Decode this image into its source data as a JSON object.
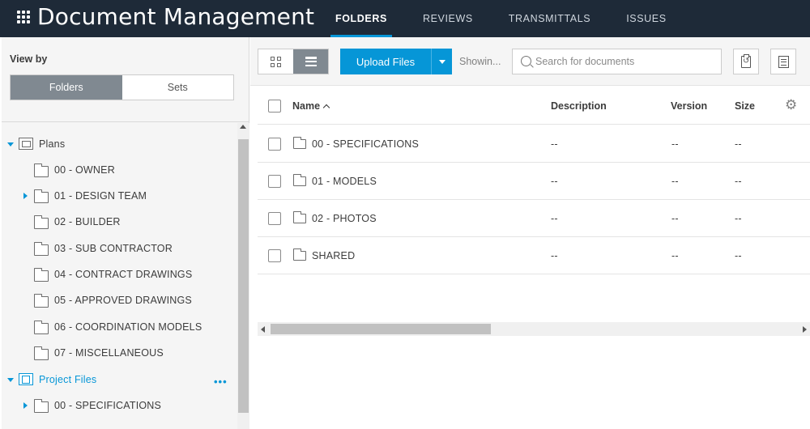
{
  "app": {
    "title": "Document Management"
  },
  "topnav": {
    "tabs": [
      {
        "label": "FOLDERS",
        "active": true
      },
      {
        "label": "REVIEWS",
        "active": false
      },
      {
        "label": "TRANSMITTALS",
        "active": false
      },
      {
        "label": "ISSUES",
        "active": false
      }
    ]
  },
  "sidebar": {
    "view_by_label": "View by",
    "toggle": {
      "folders_label": "Folders",
      "sets_label": "Sets",
      "selected": "Folders"
    },
    "tree": [
      {
        "label": "Plans",
        "expanded": true,
        "icon": "plans-icon"
      },
      {
        "label": "00 - OWNER",
        "icon": "folder-icon"
      },
      {
        "label": "01 - DESIGN TEAM",
        "icon": "folder-icon",
        "collapsed_caret": true
      },
      {
        "label": "02 - BUILDER",
        "icon": "folder-icon"
      },
      {
        "label": "03 - SUB CONTRACTOR",
        "icon": "folder-icon"
      },
      {
        "label": "04 - CONTRACT DRAWINGS",
        "icon": "folder-icon"
      },
      {
        "label": "05 - APPROVED DRAWINGS",
        "icon": "folder-icon"
      },
      {
        "label": "06 - COORDINATION MODELS",
        "icon": "folder-icon"
      },
      {
        "label": "07 - MISCELLANEOUS",
        "icon": "folder-icon"
      },
      {
        "label": "Project Files",
        "expanded": true,
        "icon": "project-files-icon",
        "selected": true
      },
      {
        "label": "00 - SPECIFICATIONS",
        "icon": "folder-icon",
        "collapsed_caret": true
      }
    ],
    "more_label": "•••"
  },
  "toolbar": {
    "upload_label": "Upload Files",
    "showing_label": "Showin...",
    "search_placeholder": "Search for documents"
  },
  "table": {
    "columns": [
      "Name",
      "Description",
      "Version",
      "Size"
    ],
    "sort_column": "Name",
    "rows": [
      {
        "name": "00 - SPECIFICATIONS",
        "description": "--",
        "version": "--",
        "size": "--"
      },
      {
        "name": "01 - MODELS",
        "description": "--",
        "version": "--",
        "size": "--"
      },
      {
        "name": "02 - PHOTOS",
        "description": "--",
        "version": "--",
        "size": "--"
      },
      {
        "name": "SHARED",
        "description": "--",
        "version": "--",
        "size": "--"
      }
    ]
  },
  "colors": {
    "topbar": "#1e2a38",
    "accent": "#0696d7",
    "toggle_active": "#808991"
  }
}
